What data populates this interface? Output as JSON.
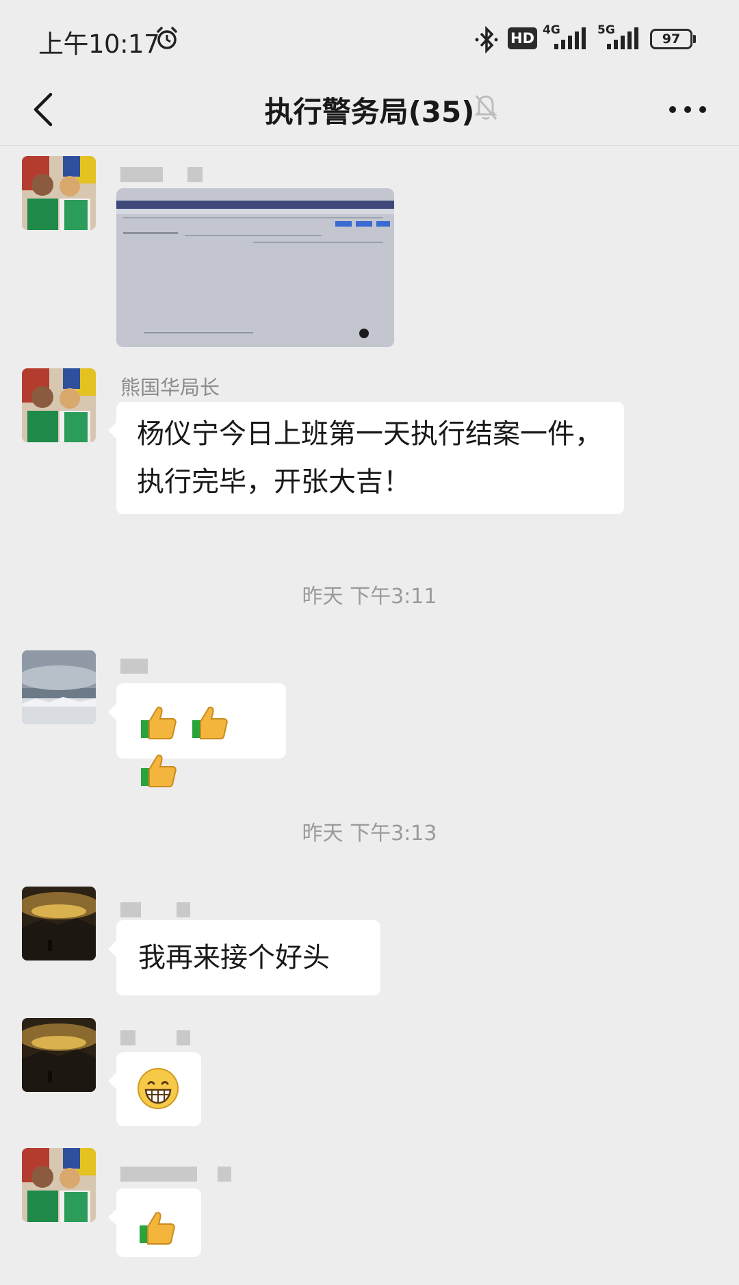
{
  "status_bar": {
    "time": "上午10:17",
    "hd_label": "HD",
    "network_1": "4G",
    "network_2": "5G",
    "battery": "97"
  },
  "nav": {
    "title": "执行警务局(35)"
  },
  "messages": [
    {
      "type": "image",
      "sender": "",
      "content": "screenshot-image"
    },
    {
      "type": "text",
      "sender": "熊国华局长",
      "text": "杨仪宁今日上班第一天执行结案一件，执行完毕，开张大吉！"
    },
    {
      "type": "timestamp",
      "text": "昨天 下午3:11"
    },
    {
      "type": "emoji",
      "sender": "",
      "emoji": [
        "thumbs-up",
        "thumbs-up",
        "thumbs-up"
      ]
    },
    {
      "type": "timestamp",
      "text": "昨天 下午3:13"
    },
    {
      "type": "text",
      "sender": "",
      "text": "我再来接个好头"
    },
    {
      "type": "emoji",
      "sender": "",
      "emoji": [
        "grin"
      ]
    },
    {
      "type": "emoji",
      "sender": "",
      "emoji": [
        "thumbs-up"
      ]
    }
  ],
  "colors": {
    "background": "#ededed",
    "bubble": "#ffffff",
    "timestamp_text": "#9a9a9a",
    "sender_text": "#8c8c8c"
  }
}
